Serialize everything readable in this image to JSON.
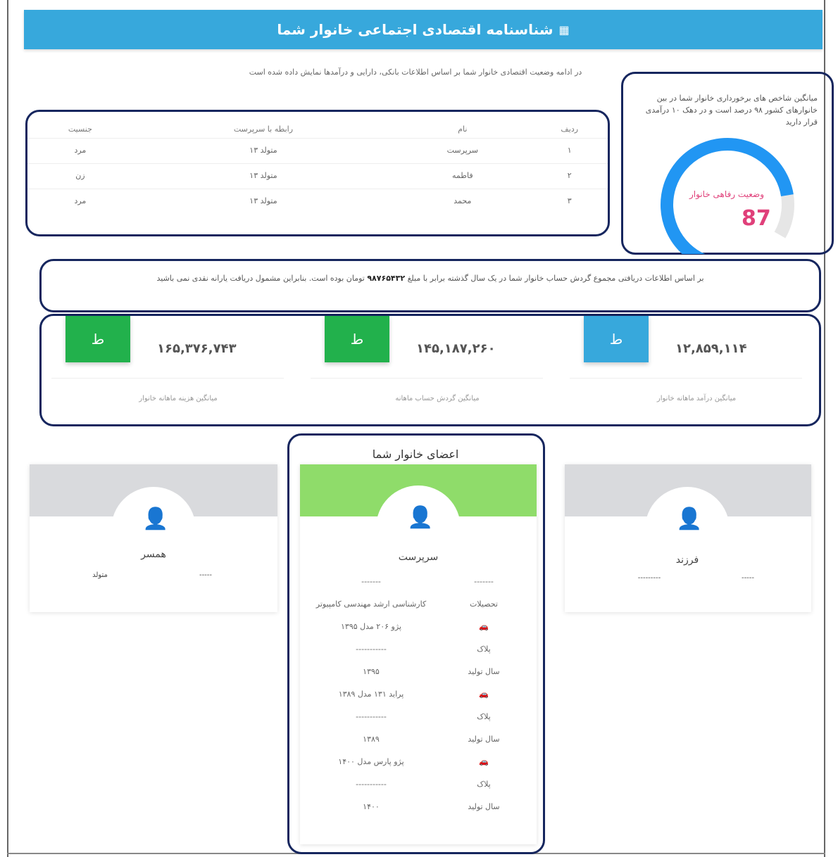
{
  "header": {
    "title": "شناسنامه اقتصادی اجتماعی خانوار شما",
    "icon": "calendar-icon"
  },
  "intro": "در ادامه وضعیت اقتصادی خانوار شما بر اساس اطلاعات بانکی، دارایی و درآمدها نمایش داده شده است",
  "members_table": {
    "headers": [
      "ردیف",
      "نام",
      "رابطه با سرپرست",
      "جنسیت"
    ],
    "rows": [
      [
        "۱",
        "سرپرست",
        "متولد ۱۳",
        "مرد"
      ],
      [
        "۲",
        "فاطمه",
        "متولد ۱۳",
        "زن"
      ],
      [
        "۳",
        "محمد",
        "متولد ۱۳",
        "مرد"
      ]
    ]
  },
  "gauge": {
    "text": "میانگین شاخص های برخورداری خانوار شما در بین خانوارهای کشور ۹۸ درصد است و در دهک ۱۰ درآمدی قرار دارید",
    "label": "وضعیت رفاهی خانوار",
    "value": "87",
    "percent": 87,
    "color": "#2196f3"
  },
  "message": {
    "text_before": "بر اساس اطلاعات دریافتی مجموع گردش حساب خانوار شما در یک سال گذشته برابر با مبلغ",
    "amount": "۹۸۷۶۵۴۳۲",
    "text_after": "تومان بوده است. بنابراین مشمول دریافت یارانه نقدی نمی باشید"
  },
  "stats": [
    {
      "amount": "۱۲,۸۵۹,۱۱۴",
      "caption": "میانگین درآمد ماهانه خانوار",
      "color": "#37a8dc",
      "badge": "ط"
    },
    {
      "amount": "۱۴۵,۱۸۷,۲۶۰",
      "caption": "میانگین گردش حساب ماهانه",
      "color": "#22b14c",
      "badge": "ط"
    },
    {
      "amount": "۱۶۵,۳۷۶,۷۴۳",
      "caption": "میانگین هزینه ماهانه خانوار",
      "color": "#22b14c",
      "badge": "ط"
    }
  ],
  "family": {
    "title": "اعضای خانوار شما",
    "left_card": {
      "name": "همسر",
      "field_a": "متولد",
      "field_b": "-----"
    },
    "right_card": {
      "name": "فرزند",
      "field_a": "---------",
      "field_b": "-----"
    },
    "mid_card": {
      "name": "سرپرست",
      "rows": [
        {
          "k": "-------",
          "v": "-------"
        },
        {
          "k": "تحصیلات",
          "v": "کارشناسی ارشد مهندسی کامپیوتر"
        },
        {
          "k": "🚗",
          "v": "پژو ۲۰۶ مدل ۱۳۹۵"
        },
        {
          "k": "پلاک",
          "v": "-----------"
        },
        {
          "k": "سال تولید",
          "v": "۱۳۹۵"
        },
        {
          "k": "🚗",
          "v": "پراید ۱۳۱ مدل ۱۳۸۹"
        },
        {
          "k": "پلاک",
          "v": "-----------"
        },
        {
          "k": "سال تولید",
          "v": "۱۳۸۹"
        },
        {
          "k": "🚗",
          "v": "پژو پارس مدل ۱۴۰۰"
        },
        {
          "k": "پلاک",
          "v": "-----------"
        },
        {
          "k": "سال تولید",
          "v": "۱۴۰۰"
        }
      ]
    }
  }
}
